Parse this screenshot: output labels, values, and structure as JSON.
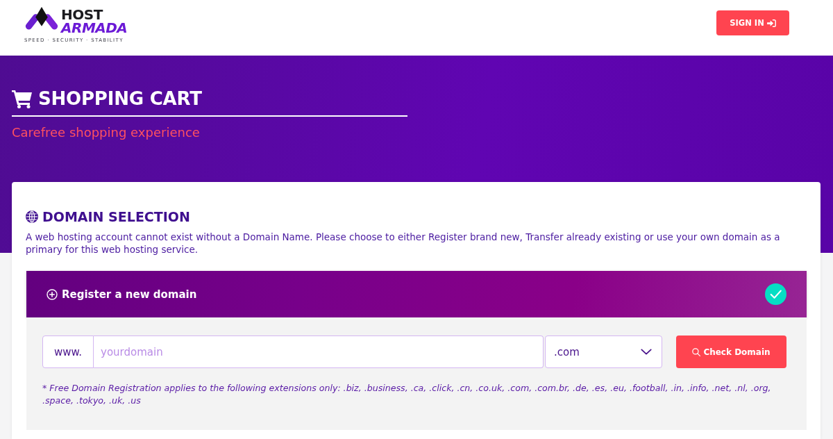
{
  "header": {
    "logo": {
      "line_1": "HOST",
      "line_2": "ARMADA",
      "tagline": "SPEED · SECURITY · STABILITY"
    },
    "sign_in": "SIGN IN"
  },
  "hero": {
    "title": "SHOPPING CART",
    "subtitle": "Carefree shopping experience"
  },
  "domain_selection": {
    "title": "DOMAIN SELECTION",
    "description": "A web hosting account cannot exist without a Domain Name. Please choose to either Register brand new, Transfer already existing or use your own domain as a primary for this web hosting service.",
    "options": [
      {
        "label": "Register a new domain",
        "selected": true,
        "prefix": "www.",
        "placeholder": "yourdomain",
        "extension": ".com",
        "button": "Check Domain",
        "note": "* Free Domain Registration applies to the following extensions only: .biz, .business, .ca, .click, .cn, .co.uk, .com, .com.br, .de, .es, .eu, .football, .in, .info, .net, .nl, .org, .space, .tokyo, .uk, .us"
      }
    ]
  }
}
